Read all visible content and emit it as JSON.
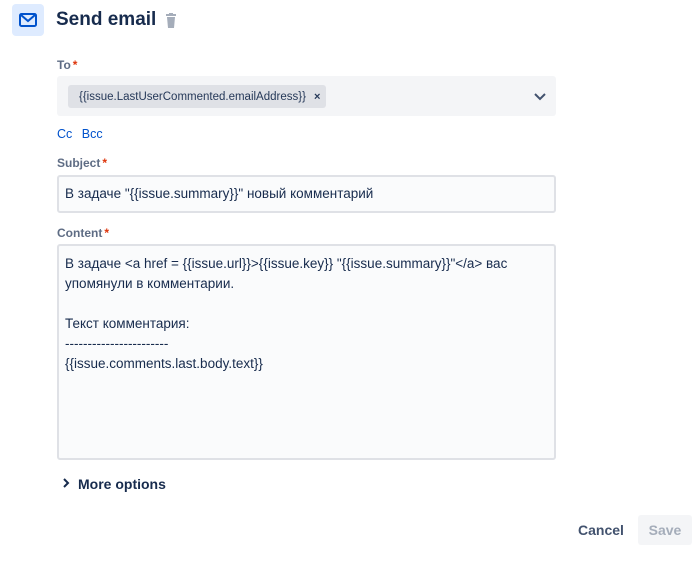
{
  "header": {
    "title": "Send email",
    "icon": "mail-icon",
    "delete_icon": "trash-icon"
  },
  "to": {
    "label": "To",
    "required_mark": "*",
    "chips": [
      {
        "value": "{{issue.LastUserCommented.emailAddress}}",
        "remove_glyph": "×"
      }
    ]
  },
  "cc_links": {
    "cc": "Cc",
    "bcc": "Bcc"
  },
  "subject": {
    "label": "Subject",
    "required_mark": "*",
    "value": "В задаче \"{{issue.summary}}\" новый комментарий"
  },
  "content": {
    "label": "Content",
    "required_mark": "*",
    "value": "В задаче <a href = {{issue.url}}>{{issue.key}} \"{{issue.summary}}\"</a> вас\nупомянули в комментарии.\n\nТекст комментария:\n-----------------------\n{{issue.comments.last.body.text}}"
  },
  "more_options": {
    "label": "More options"
  },
  "actions": {
    "cancel": "Cancel",
    "save": "Save"
  },
  "colors": {
    "accent": "#0052cc",
    "required": "#de350b",
    "icon_bg": "#deebff"
  }
}
